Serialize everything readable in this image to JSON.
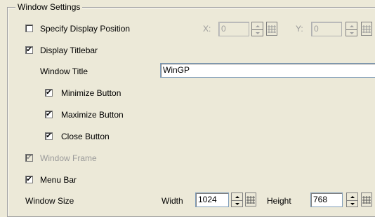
{
  "group": {
    "title": "Window Settings"
  },
  "display_position": {
    "label": "Specify Display Position",
    "checked": false,
    "x_label": "X:",
    "x_value": "0",
    "y_label": "Y:",
    "y_value": "0"
  },
  "titlebar": {
    "label": "Display Titlebar",
    "checked": true
  },
  "window_title": {
    "label": "Window Title",
    "value": "WinGP"
  },
  "minimize": {
    "label": "Minimize Button",
    "checked": true
  },
  "maximize": {
    "label": "Maximize Button",
    "checked": true
  },
  "close": {
    "label": "Close Button",
    "checked": true
  },
  "window_frame": {
    "label": "Window Frame",
    "checked": true,
    "disabled": true
  },
  "menu_bar": {
    "label": "Menu Bar",
    "checked": true
  },
  "window_size": {
    "label": "Window Size",
    "width_label": "Width",
    "width_value": "1024",
    "height_label": "Height",
    "height_value": "768"
  },
  "icons": {
    "checkmark": "checkmark-icon",
    "spin_up": "spin-up-icon",
    "spin_down": "spin-down-icon",
    "keypad": "keypad-icon"
  }
}
